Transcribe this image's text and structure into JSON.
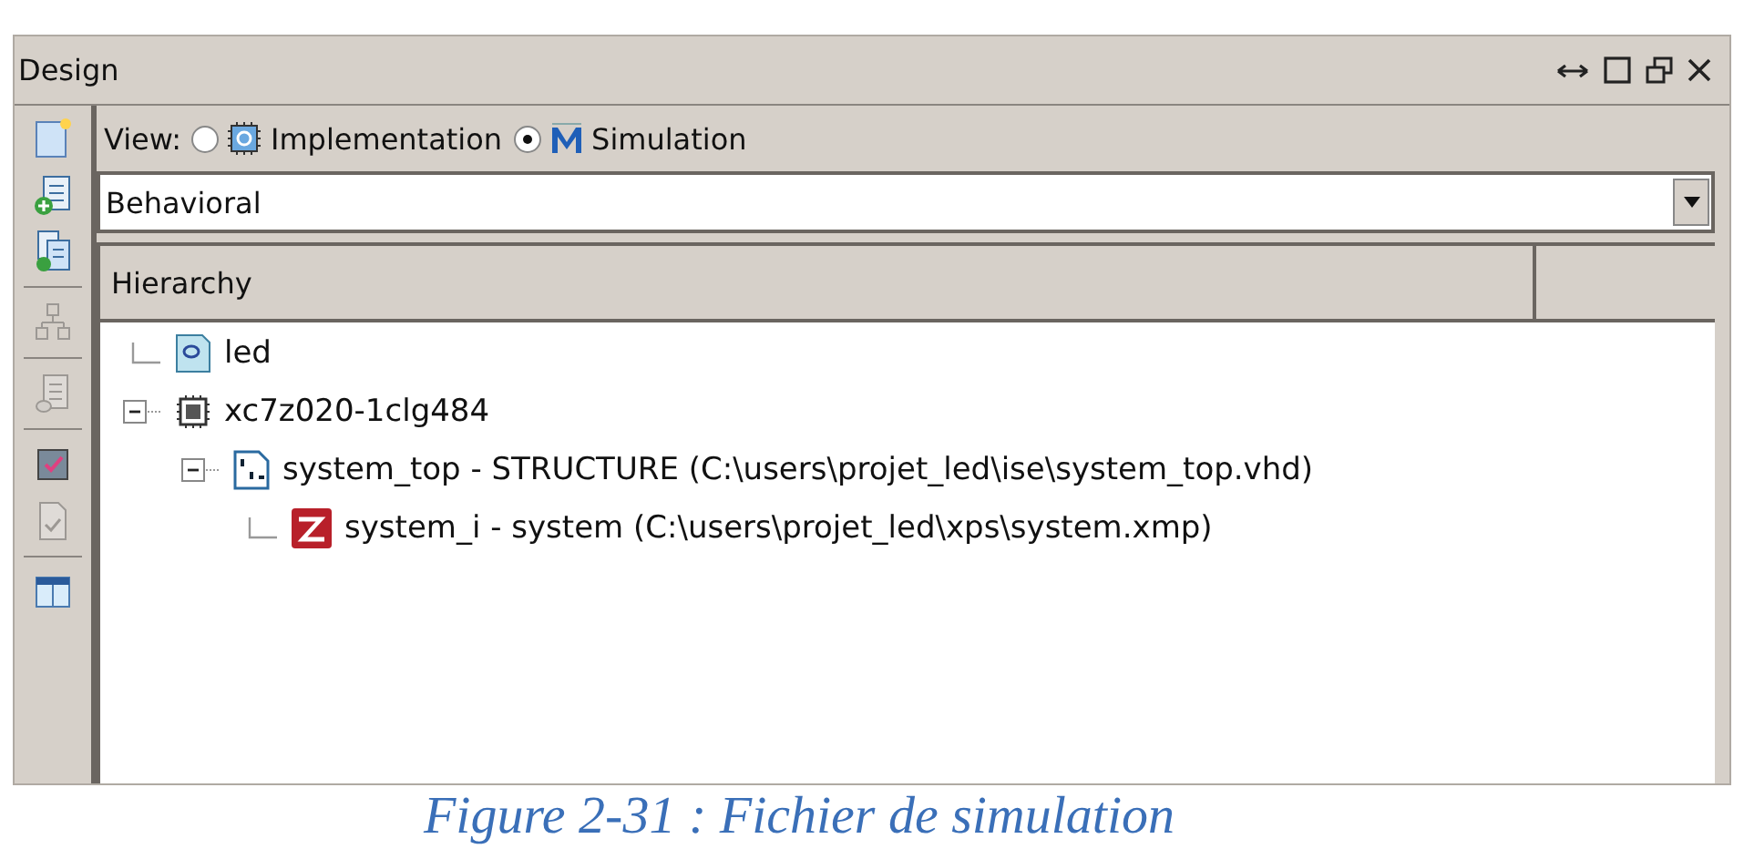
{
  "panel": {
    "title": "Design"
  },
  "toolbar": [
    {
      "kind": "new",
      "disabled": false
    },
    {
      "kind": "add",
      "disabled": false
    },
    {
      "kind": "add-copy",
      "disabled": false
    },
    {
      "kind": "hierarchy",
      "disabled": true
    },
    {
      "kind": "document",
      "disabled": true
    },
    {
      "kind": "chip",
      "disabled": false
    },
    {
      "kind": "check",
      "disabled": true
    },
    {
      "kind": "table",
      "disabled": false
    }
  ],
  "view": {
    "label": "View:",
    "options": [
      {
        "label": "Implementation",
        "kind": "implementation",
        "selected": false
      },
      {
        "label": "Simulation",
        "kind": "simulation",
        "selected": true
      }
    ]
  },
  "dropdown": {
    "value": "Behavioral"
  },
  "hierarchy": {
    "header": "Hierarchy",
    "items": [
      {
        "label": "led",
        "kind": "module"
      },
      {
        "label": "xc7z020-1clg484",
        "kind": "device",
        "expanded": true,
        "children": [
          {
            "label": "system_top - STRUCTURE (C:\\users\\projet_led\\ise\\system_top.vhd)",
            "kind": "vhdl",
            "expanded": true,
            "children": [
              {
                "label": "system_i - system (C:\\users\\projet_led\\xps\\system.xmp)",
                "kind": "xps"
              }
            ]
          }
        ]
      }
    ]
  },
  "caption": "Figure 2-31 : Fichier de simulation"
}
